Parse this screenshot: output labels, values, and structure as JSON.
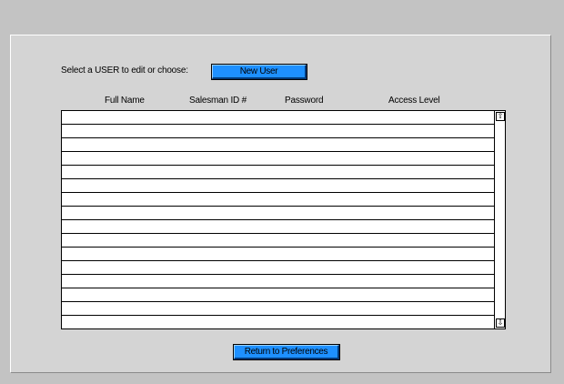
{
  "prompt_label": "Select a USER to edit or choose:",
  "new_user_button": "New User",
  "columns": {
    "full_name": "Full Name",
    "salesman_id": "Salesman ID #",
    "password": "Password",
    "access_level": "Access Level"
  },
  "rows": [],
  "return_button": "Return to Preferences",
  "icons": {
    "scroll_up": "scroll-up-arrow-icon",
    "scroll_down": "scroll-down-arrow-icon"
  },
  "colors": {
    "button": "#1e90ff",
    "panel": "#d4d4d4",
    "background": "#c3c3c3"
  }
}
